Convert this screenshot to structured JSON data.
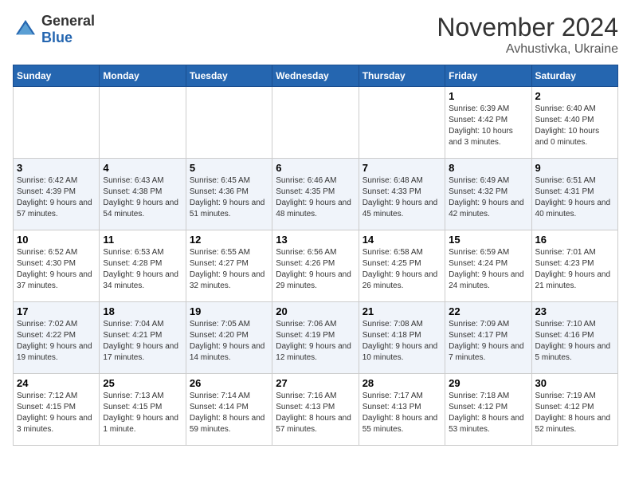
{
  "header": {
    "logo_general": "General",
    "logo_blue": "Blue",
    "month_title": "November 2024",
    "location": "Avhustivka, Ukraine"
  },
  "days_of_week": [
    "Sunday",
    "Monday",
    "Tuesday",
    "Wednesday",
    "Thursday",
    "Friday",
    "Saturday"
  ],
  "weeks": [
    [
      {
        "day": "",
        "sunrise": "",
        "sunset": "",
        "daylight": ""
      },
      {
        "day": "",
        "sunrise": "",
        "sunset": "",
        "daylight": ""
      },
      {
        "day": "",
        "sunrise": "",
        "sunset": "",
        "daylight": ""
      },
      {
        "day": "",
        "sunrise": "",
        "sunset": "",
        "daylight": ""
      },
      {
        "day": "",
        "sunrise": "",
        "sunset": "",
        "daylight": ""
      },
      {
        "day": "1",
        "sunrise": "Sunrise: 6:39 AM",
        "sunset": "Sunset: 4:42 PM",
        "daylight": "Daylight: 10 hours and 3 minutes."
      },
      {
        "day": "2",
        "sunrise": "Sunrise: 6:40 AM",
        "sunset": "Sunset: 4:40 PM",
        "daylight": "Daylight: 10 hours and 0 minutes."
      }
    ],
    [
      {
        "day": "3",
        "sunrise": "Sunrise: 6:42 AM",
        "sunset": "Sunset: 4:39 PM",
        "daylight": "Daylight: 9 hours and 57 minutes."
      },
      {
        "day": "4",
        "sunrise": "Sunrise: 6:43 AM",
        "sunset": "Sunset: 4:38 PM",
        "daylight": "Daylight: 9 hours and 54 minutes."
      },
      {
        "day": "5",
        "sunrise": "Sunrise: 6:45 AM",
        "sunset": "Sunset: 4:36 PM",
        "daylight": "Daylight: 9 hours and 51 minutes."
      },
      {
        "day": "6",
        "sunrise": "Sunrise: 6:46 AM",
        "sunset": "Sunset: 4:35 PM",
        "daylight": "Daylight: 9 hours and 48 minutes."
      },
      {
        "day": "7",
        "sunrise": "Sunrise: 6:48 AM",
        "sunset": "Sunset: 4:33 PM",
        "daylight": "Daylight: 9 hours and 45 minutes."
      },
      {
        "day": "8",
        "sunrise": "Sunrise: 6:49 AM",
        "sunset": "Sunset: 4:32 PM",
        "daylight": "Daylight: 9 hours and 42 minutes."
      },
      {
        "day": "9",
        "sunrise": "Sunrise: 6:51 AM",
        "sunset": "Sunset: 4:31 PM",
        "daylight": "Daylight: 9 hours and 40 minutes."
      }
    ],
    [
      {
        "day": "10",
        "sunrise": "Sunrise: 6:52 AM",
        "sunset": "Sunset: 4:30 PM",
        "daylight": "Daylight: 9 hours and 37 minutes."
      },
      {
        "day": "11",
        "sunrise": "Sunrise: 6:53 AM",
        "sunset": "Sunset: 4:28 PM",
        "daylight": "Daylight: 9 hours and 34 minutes."
      },
      {
        "day": "12",
        "sunrise": "Sunrise: 6:55 AM",
        "sunset": "Sunset: 4:27 PM",
        "daylight": "Daylight: 9 hours and 32 minutes."
      },
      {
        "day": "13",
        "sunrise": "Sunrise: 6:56 AM",
        "sunset": "Sunset: 4:26 PM",
        "daylight": "Daylight: 9 hours and 29 minutes."
      },
      {
        "day": "14",
        "sunrise": "Sunrise: 6:58 AM",
        "sunset": "Sunset: 4:25 PM",
        "daylight": "Daylight: 9 hours and 26 minutes."
      },
      {
        "day": "15",
        "sunrise": "Sunrise: 6:59 AM",
        "sunset": "Sunset: 4:24 PM",
        "daylight": "Daylight: 9 hours and 24 minutes."
      },
      {
        "day": "16",
        "sunrise": "Sunrise: 7:01 AM",
        "sunset": "Sunset: 4:23 PM",
        "daylight": "Daylight: 9 hours and 21 minutes."
      }
    ],
    [
      {
        "day": "17",
        "sunrise": "Sunrise: 7:02 AM",
        "sunset": "Sunset: 4:22 PM",
        "daylight": "Daylight: 9 hours and 19 minutes."
      },
      {
        "day": "18",
        "sunrise": "Sunrise: 7:04 AM",
        "sunset": "Sunset: 4:21 PM",
        "daylight": "Daylight: 9 hours and 17 minutes."
      },
      {
        "day": "19",
        "sunrise": "Sunrise: 7:05 AM",
        "sunset": "Sunset: 4:20 PM",
        "daylight": "Daylight: 9 hours and 14 minutes."
      },
      {
        "day": "20",
        "sunrise": "Sunrise: 7:06 AM",
        "sunset": "Sunset: 4:19 PM",
        "daylight": "Daylight: 9 hours and 12 minutes."
      },
      {
        "day": "21",
        "sunrise": "Sunrise: 7:08 AM",
        "sunset": "Sunset: 4:18 PM",
        "daylight": "Daylight: 9 hours and 10 minutes."
      },
      {
        "day": "22",
        "sunrise": "Sunrise: 7:09 AM",
        "sunset": "Sunset: 4:17 PM",
        "daylight": "Daylight: 9 hours and 7 minutes."
      },
      {
        "day": "23",
        "sunrise": "Sunrise: 7:10 AM",
        "sunset": "Sunset: 4:16 PM",
        "daylight": "Daylight: 9 hours and 5 minutes."
      }
    ],
    [
      {
        "day": "24",
        "sunrise": "Sunrise: 7:12 AM",
        "sunset": "Sunset: 4:15 PM",
        "daylight": "Daylight: 9 hours and 3 minutes."
      },
      {
        "day": "25",
        "sunrise": "Sunrise: 7:13 AM",
        "sunset": "Sunset: 4:15 PM",
        "daylight": "Daylight: 9 hours and 1 minute."
      },
      {
        "day": "26",
        "sunrise": "Sunrise: 7:14 AM",
        "sunset": "Sunset: 4:14 PM",
        "daylight": "Daylight: 8 hours and 59 minutes."
      },
      {
        "day": "27",
        "sunrise": "Sunrise: 7:16 AM",
        "sunset": "Sunset: 4:13 PM",
        "daylight": "Daylight: 8 hours and 57 minutes."
      },
      {
        "day": "28",
        "sunrise": "Sunrise: 7:17 AM",
        "sunset": "Sunset: 4:13 PM",
        "daylight": "Daylight: 8 hours and 55 minutes."
      },
      {
        "day": "29",
        "sunrise": "Sunrise: 7:18 AM",
        "sunset": "Sunset: 4:12 PM",
        "daylight": "Daylight: 8 hours and 53 minutes."
      },
      {
        "day": "30",
        "sunrise": "Sunrise: 7:19 AM",
        "sunset": "Sunset: 4:12 PM",
        "daylight": "Daylight: 8 hours and 52 minutes."
      }
    ]
  ]
}
